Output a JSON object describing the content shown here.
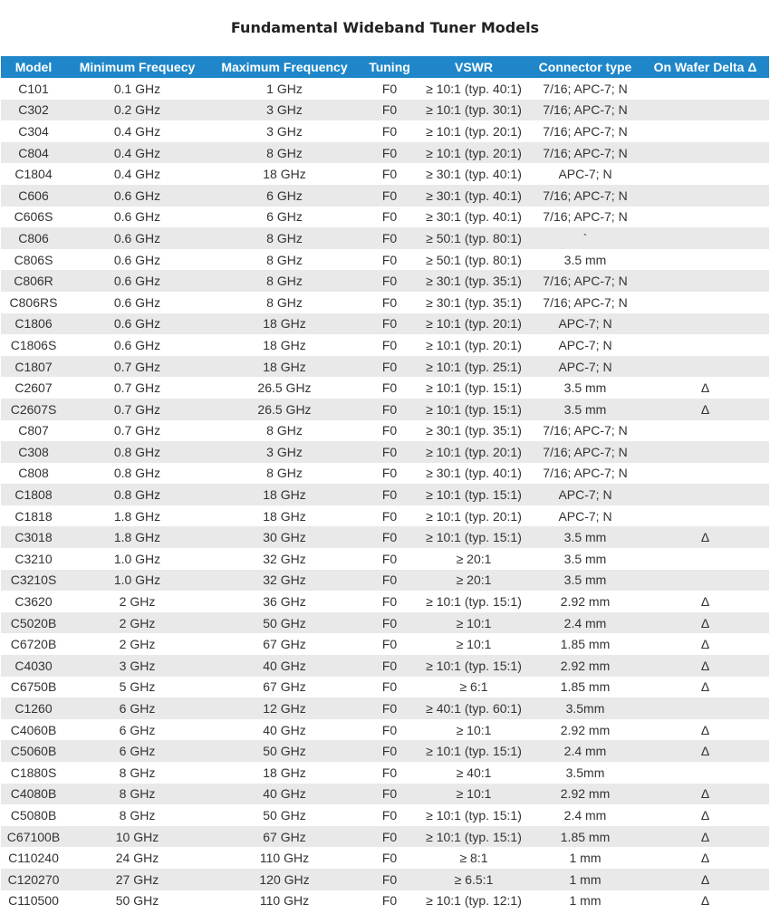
{
  "title": "Fundamental Wideband Tuner Models",
  "columns": [
    "Model",
    "Minimum Frequecy",
    "Maximum Frequency",
    "Tuning",
    "VSWR",
    "Connector type",
    "On Wafer Delta Δ"
  ],
  "rows": [
    [
      "C101",
      "0.1 GHz",
      "1 GHz",
      "F0",
      "≥ 10:1 (typ. 40:1)",
      "7/16; APC-7; N",
      ""
    ],
    [
      "C302",
      "0.2 GHz",
      "3 GHz",
      "F0",
      "≥ 10:1 (typ. 30:1)",
      "7/16; APC-7; N",
      ""
    ],
    [
      "C304",
      "0.4 GHz",
      "3 GHz",
      "F0",
      "≥ 10:1 (typ. 20:1)",
      "7/16; APC-7; N",
      ""
    ],
    [
      "C804",
      "0.4 GHz",
      "8 GHz",
      "F0",
      "≥ 10:1 (typ. 20:1)",
      "7/16; APC-7; N",
      ""
    ],
    [
      "C1804",
      "0.4 GHz",
      "18 GHz",
      "F0",
      "≥ 30:1 (typ. 40:1)",
      "APC-7; N",
      ""
    ],
    [
      "C606",
      "0.6 GHz",
      "6 GHz",
      "F0",
      "≥ 30:1 (typ. 40:1)",
      "7/16; APC-7; N",
      ""
    ],
    [
      "C606S",
      "0.6 GHz",
      "6 GHz",
      "F0",
      "≥ 30:1 (typ. 40:1)",
      "7/16; APC-7; N",
      ""
    ],
    [
      "C806",
      "0.6 GHz",
      "8 GHz",
      "F0",
      "≥ 50:1 (typ. 80:1)",
      "`",
      ""
    ],
    [
      "C806S",
      "0.6 GHz",
      "8 GHz",
      "F0",
      "≥ 50:1 (typ. 80:1)",
      "3.5 mm",
      ""
    ],
    [
      "C806R",
      "0.6 GHz",
      "8 GHz",
      "F0",
      "≥ 30:1 (typ. 35:1)",
      "7/16; APC-7; N",
      ""
    ],
    [
      "C806RS",
      "0.6 GHz",
      "8 GHz",
      "F0",
      "≥ 30:1 (typ. 35:1)",
      "7/16; APC-7; N",
      ""
    ],
    [
      "C1806",
      "0.6 GHz",
      "18 GHz",
      "F0",
      "≥ 10:1 (typ. 20:1)",
      "APC-7; N",
      ""
    ],
    [
      "C1806S",
      "0.6 GHz",
      "18 GHz",
      "F0",
      "≥ 10:1 (typ. 20:1)",
      "APC-7; N",
      ""
    ],
    [
      "C1807",
      "0.7 GHz",
      "18 GHz",
      "F0",
      "≥ 10:1 (typ. 25:1)",
      "APC-7; N",
      ""
    ],
    [
      "C2607",
      "0.7 GHz",
      "26.5 GHz",
      "F0",
      "≥ 10:1 (typ. 15:1)",
      "3.5 mm",
      "Δ"
    ],
    [
      "C2607S",
      "0.7 GHz",
      "26.5 GHz",
      "F0",
      "≥ 10:1 (typ. 15:1)",
      "3.5 mm",
      "Δ"
    ],
    [
      "C807",
      "0.7 GHz",
      "8 GHz",
      "F0",
      "≥ 30:1 (typ. 35:1)",
      "7/16; APC-7; N",
      ""
    ],
    [
      "C308",
      "0.8 GHz",
      "3 GHz",
      "F0",
      "≥ 10:1 (typ. 20:1)",
      "7/16; APC-7; N",
      ""
    ],
    [
      "C808",
      "0.8 GHz",
      "8 GHz",
      "F0",
      "≥ 30:1 (typ. 40:1)",
      "7/16; APC-7; N",
      ""
    ],
    [
      "C1808",
      "0.8 GHz",
      "18 GHz",
      "F0",
      "≥ 10:1 (typ. 15:1)",
      "APC-7; N",
      ""
    ],
    [
      "C1818",
      "1.8 GHz",
      "18 GHz",
      "F0",
      "≥ 10:1 (typ. 20:1)",
      "APC-7; N",
      ""
    ],
    [
      "C3018",
      "1.8 GHz",
      "30 GHz",
      "F0",
      "≥ 10:1 (typ. 15:1)",
      "3.5 mm",
      "Δ"
    ],
    [
      "C3210",
      "1.0 GHz",
      "32 GHz",
      "F0",
      "≥ 20:1",
      "3.5 mm",
      ""
    ],
    [
      "C3210S",
      "1.0 GHz",
      "32 GHz",
      "F0",
      "≥ 20:1",
      "3.5 mm",
      ""
    ],
    [
      "C3620",
      "2 GHz",
      "36 GHz",
      "F0",
      "≥ 10:1 (typ. 15:1)",
      "2.92 mm",
      "Δ"
    ],
    [
      "C5020B",
      "2 GHz",
      "50 GHz",
      "F0",
      "≥ 10:1",
      "2.4 mm",
      "Δ"
    ],
    [
      "C6720B",
      "2 GHz",
      "67 GHz",
      "F0",
      "≥ 10:1",
      "1.85 mm",
      "Δ"
    ],
    [
      "C4030",
      "3 GHz",
      "40 GHz",
      "F0",
      "≥ 10:1 (typ. 15:1)",
      "2.92 mm",
      "Δ"
    ],
    [
      "C6750B",
      "5 GHz",
      "67 GHz",
      "F0",
      "≥ 6:1",
      "1.85 mm",
      "Δ"
    ],
    [
      "C1260",
      "6 GHz",
      "12 GHz",
      "F0",
      "≥ 40:1 (typ. 60:1)",
      "3.5mm",
      ""
    ],
    [
      "C4060B",
      "6 GHz",
      "40 GHz",
      "F0",
      "≥ 10:1",
      "2.92 mm",
      "Δ"
    ],
    [
      "C5060B",
      "6 GHz",
      "50 GHz",
      "F0",
      "≥ 10:1 (typ. 15:1)",
      "2.4 mm",
      "Δ"
    ],
    [
      "C1880S",
      "8 GHz",
      "18 GHz",
      "F0",
      "≥ 40:1",
      "3.5mm",
      ""
    ],
    [
      "C4080B",
      "8 GHz",
      "40 GHz",
      "F0",
      "≥ 10:1",
      "2.92 mm",
      "Δ"
    ],
    [
      "C5080B",
      "8 GHz",
      "50 GHz",
      "F0",
      "≥ 10:1 (typ. 15:1)",
      "2.4 mm",
      "Δ"
    ],
    [
      "C67100B",
      "10 GHz",
      "67 GHz",
      "F0",
      "≥ 10:1 (typ. 15:1)",
      "1.85 mm",
      "Δ"
    ],
    [
      "C110240",
      "24 GHz",
      "110 GHz",
      "F0",
      "≥ 8:1",
      "1 mm",
      "Δ"
    ],
    [
      "C120270",
      "27 GHz",
      "120 GHz",
      "F0",
      "≥ 6.5:1",
      "1 mm",
      "Δ"
    ],
    [
      "C110500",
      "50 GHz",
      "110 GHz",
      "F0",
      "≥ 10:1 (typ. 12:1)",
      "1 mm",
      "Δ"
    ]
  ]
}
